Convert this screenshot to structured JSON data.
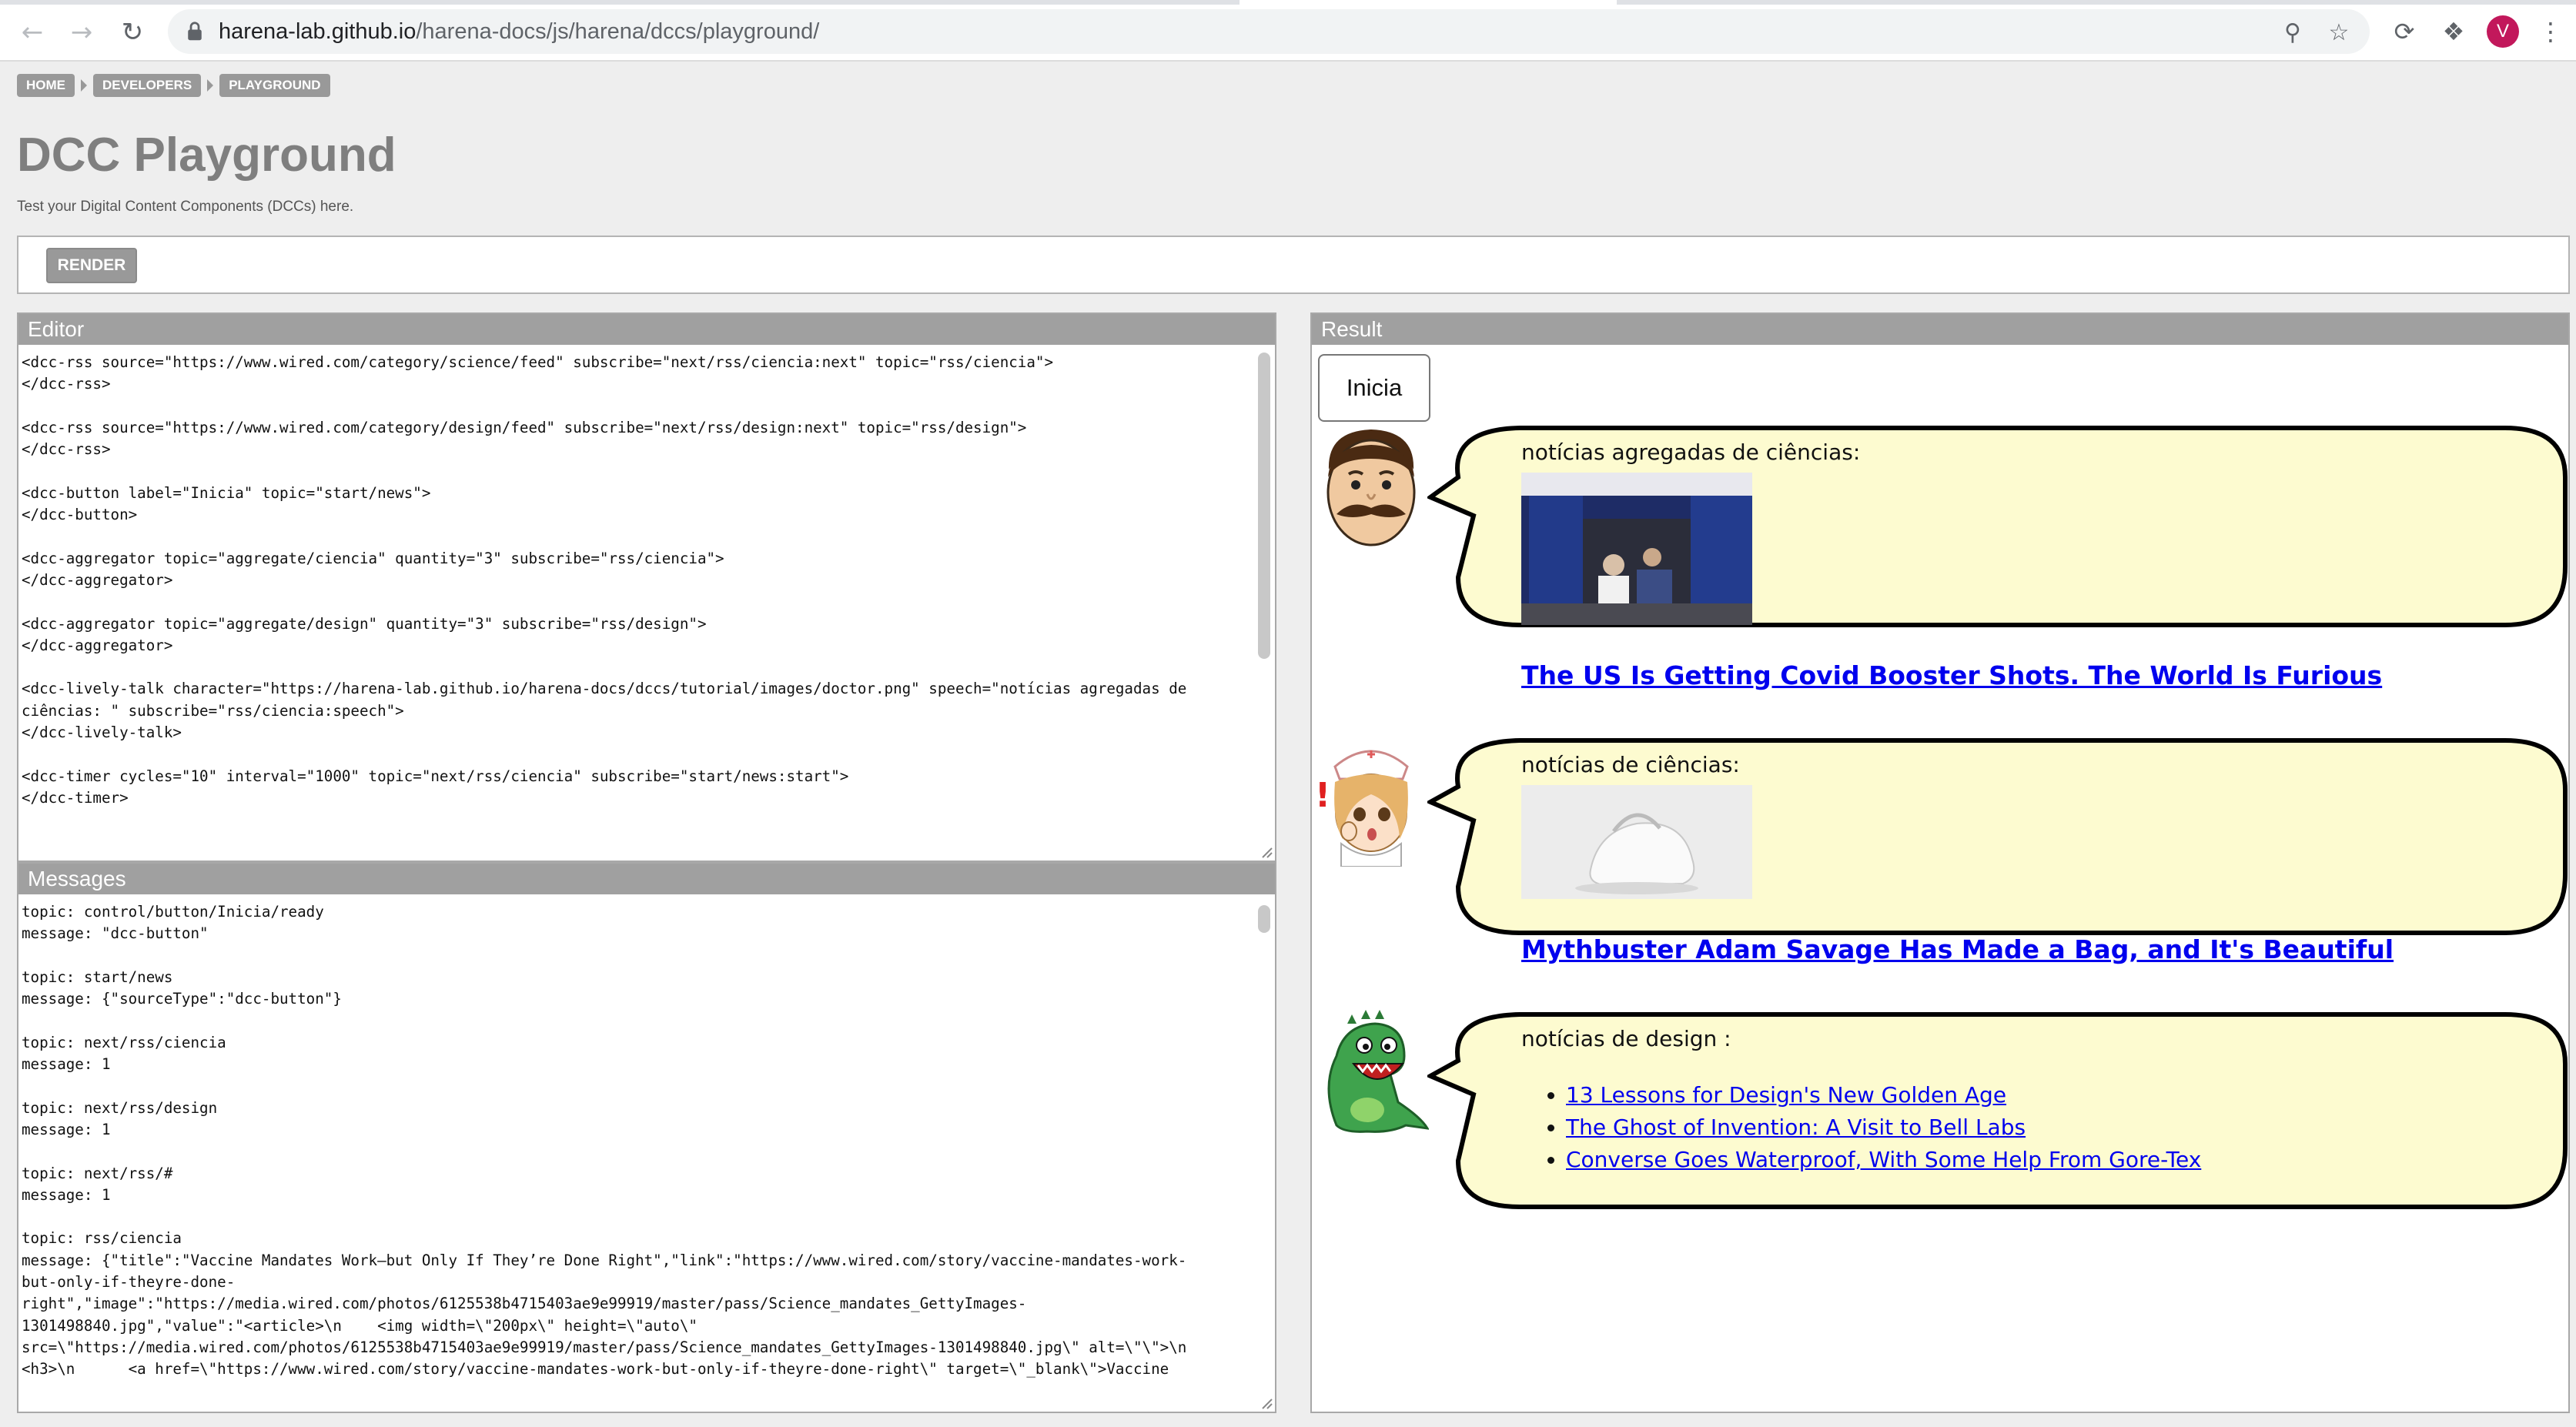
{
  "browser": {
    "url_host": "harena-lab.github.io",
    "url_path": "/harena-docs/js/harena/dccs/playground/",
    "profile_initial": "V"
  },
  "breadcrumb": [
    "HOME",
    "DEVELOPERS",
    "PLAYGROUND"
  ],
  "page": {
    "title": "DCC Playground",
    "subtitle": "Test your Digital Content Components (DCCs) here.",
    "render_label": "RENDER"
  },
  "editor": {
    "header": "Editor",
    "lines": [
      "<dcc-rss source=\"https://www.wired.com/category/science/feed\" subscribe=\"next/rss/ciencia:next\" topic=\"rss/ciencia\">",
      "</dcc-rss>",
      "",
      "<dcc-rss source=\"https://www.wired.com/category/design/feed\" subscribe=\"next/rss/design:next\" topic=\"rss/design\">",
      "</dcc-rss>",
      "",
      "<dcc-button label=\"Inicia\" topic=\"start/news\">",
      "</dcc-button>",
      "",
      "<dcc-aggregator topic=\"aggregate/ciencia\" quantity=\"3\" subscribe=\"rss/ciencia\">",
      "</dcc-aggregator>",
      "",
      "<dcc-aggregator topic=\"aggregate/design\" quantity=\"3\" subscribe=\"rss/design\">",
      "</dcc-aggregator>",
      "",
      "<dcc-lively-talk character=\"https://harena-lab.github.io/harena-docs/dccs/tutorial/images/doctor.png\" speech=\"notícias agregadas de",
      "ciências: \" subscribe=\"rss/ciencia:speech\">",
      "</dcc-lively-talk>",
      "",
      "<dcc-timer cycles=\"10\" interval=\"1000\" topic=\"next/rss/ciencia\" subscribe=\"start/news:start\">",
      "</dcc-timer>"
    ]
  },
  "messages": {
    "header": "Messages",
    "lines": [
      "topic: control/button/Inicia/ready",
      "message: \"dcc-button\"",
      "",
      "topic: start/news",
      "message: {\"sourceType\":\"dcc-button\"}",
      "",
      "topic: next/rss/ciencia",
      "message: 1",
      "",
      "topic: next/rss/design",
      "message: 1",
      "",
      "topic: next/rss/#",
      "message: 1",
      "",
      "topic: rss/ciencia",
      "message: {\"title\":\"Vaccine Mandates Work—but Only If They’re Done Right\",\"link\":\"https://www.wired.com/story/vaccine-mandates-work-",
      "but-only-if-theyre-done-",
      "right\",\"image\":\"https://media.wired.com/photos/6125538b4715403ae9e99919/master/pass/Science_mandates_GettyImages-",
      "1301498840.jpg\",\"value\":\"<article>\\n    <img width=\\\"200px\\\" height=\\\"auto\\\"",
      "src=\\\"https://media.wired.com/photos/6125538b4715403ae9e99919/master/pass/Science_mandates_GettyImages-1301498840.jpg\\\" alt=\\\"\\\">\\n",
      "<h3>\\n      <a href=\\\"https://www.wired.com/story/vaccine-mandates-work-but-only-if-theyre-done-right\\\" target=\\\"_blank\\\">Vaccine"
    ]
  },
  "result": {
    "header": "Result",
    "inicia_label": "Inicia",
    "talks": [
      {
        "character": "doctor-character",
        "speech": "notícias agregadas de ciências:",
        "link": "The US Is Getting Covid Booster Shots. The World Is Furious"
      },
      {
        "character": "nurse-character",
        "speech": "notícias de ciências:",
        "link": "Mythbuster Adam Savage Has Made a Bag, and It's Beautiful"
      },
      {
        "character": "dinosaur-character",
        "speech": "notícias de design :",
        "items": [
          "13 Lessons for Design's New Golden Age",
          "The Ghost of Invention: A Visit to Bell Labs",
          "Converse Goes Waterproof, With Some Help From Gore-Tex"
        ]
      }
    ]
  },
  "colors": {
    "panel_header": "#a0a0a0",
    "bubble_fill": "#fdfbd0",
    "link": "#0000ee",
    "profile": "#c2185b"
  }
}
